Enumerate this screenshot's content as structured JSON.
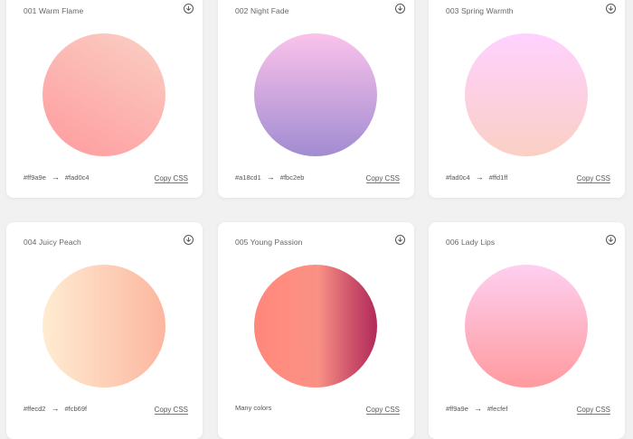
{
  "cards": [
    {
      "title": "001 Warm Flame",
      "from": "#ff9a9e",
      "to": "#fad0c4",
      "copy": "Copy CSS"
    },
    {
      "title": "002 Night Fade",
      "from": "#a18cd1",
      "to": "#fbc2eb",
      "copy": "Copy CSS"
    },
    {
      "title": "003 Spring Warmth",
      "from": "#fad0c4",
      "to": "#ffd1ff",
      "copy": "Copy CSS"
    },
    {
      "title": "004 Juicy Peach",
      "from": "#ffecd2",
      "to": "#fcb69f",
      "copy": "Copy CSS"
    },
    {
      "title": "005 Young Passion",
      "colors_label": "Many colors",
      "copy": "Copy CSS"
    },
    {
      "title": "006 Lady Lips",
      "from": "#ff9a9e",
      "to": "#fecfef",
      "copy": "Copy CSS"
    }
  ],
  "arrow": "→",
  "icons": {
    "download": "download-circle-icon"
  }
}
